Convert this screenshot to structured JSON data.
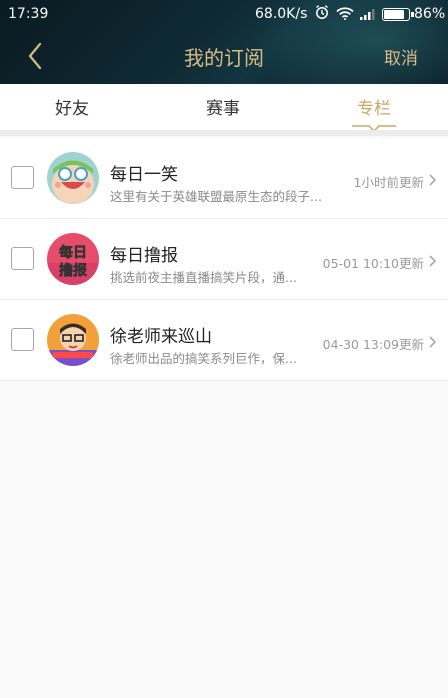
{
  "status_bar": {
    "time": "17:39",
    "speed": "68.0K/s",
    "battery": "86%"
  },
  "header": {
    "title": "我的订阅",
    "cancel_label": "取消"
  },
  "tabs": [
    {
      "label": "好友",
      "active": false
    },
    {
      "label": "赛事",
      "active": false
    },
    {
      "label": "专栏",
      "active": true
    }
  ],
  "subscriptions": [
    {
      "name": "每日一笑",
      "desc": "这里有关于英雄联盟最原生态的段子...",
      "updated": "1小时前更新"
    },
    {
      "name": "每日撸报",
      "desc": "挑选前夜主播直播搞笑片段，通...",
      "updated": "05-01 10:10更新"
    },
    {
      "name": "徐老师来巡山",
      "desc": "徐老师出品的搞笑系列巨作，保...",
      "updated": "04-30 13:09更新"
    }
  ],
  "avatar_text": {
    "row2_top": "每日",
    "row2_bottom": "撸报"
  },
  "colors": {
    "accent_gold": "#c9a763",
    "header_bg": "#0f2a33"
  }
}
